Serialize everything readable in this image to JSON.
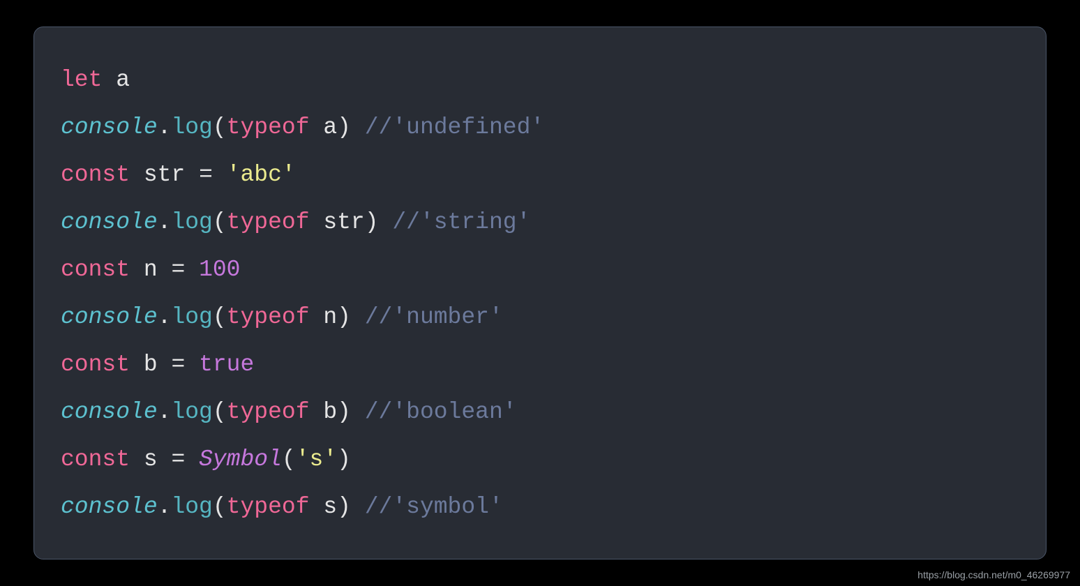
{
  "watermark": "https://blog.csdn.net/m0_46269977",
  "code": {
    "lines": [
      [
        {
          "t": "let",
          "c": "kw"
        },
        {
          "t": " ",
          "c": "punct"
        },
        {
          "t": "a",
          "c": "ident"
        }
      ],
      [
        {
          "t": "console",
          "c": "obj"
        },
        {
          "t": ".",
          "c": "punct"
        },
        {
          "t": "log",
          "c": "method"
        },
        {
          "t": "(",
          "c": "punct"
        },
        {
          "t": "typeof",
          "c": "kw"
        },
        {
          "t": " ",
          "c": "punct"
        },
        {
          "t": "a",
          "c": "ident"
        },
        {
          "t": ") ",
          "c": "punct"
        },
        {
          "t": "//'undefined'",
          "c": "comment"
        }
      ],
      [
        {
          "t": "const",
          "c": "kw"
        },
        {
          "t": " ",
          "c": "punct"
        },
        {
          "t": "str",
          "c": "ident"
        },
        {
          "t": " = ",
          "c": "punct"
        },
        {
          "t": "'abc'",
          "c": "str"
        }
      ],
      [
        {
          "t": "console",
          "c": "obj"
        },
        {
          "t": ".",
          "c": "punct"
        },
        {
          "t": "log",
          "c": "method"
        },
        {
          "t": "(",
          "c": "punct"
        },
        {
          "t": "typeof",
          "c": "kw"
        },
        {
          "t": " ",
          "c": "punct"
        },
        {
          "t": "str",
          "c": "ident"
        },
        {
          "t": ") ",
          "c": "punct"
        },
        {
          "t": "//'string'",
          "c": "comment"
        }
      ],
      [
        {
          "t": "const",
          "c": "kw"
        },
        {
          "t": " ",
          "c": "punct"
        },
        {
          "t": "n",
          "c": "ident"
        },
        {
          "t": " = ",
          "c": "punct"
        },
        {
          "t": "100",
          "c": "num"
        }
      ],
      [
        {
          "t": "console",
          "c": "obj"
        },
        {
          "t": ".",
          "c": "punct"
        },
        {
          "t": "log",
          "c": "method"
        },
        {
          "t": "(",
          "c": "punct"
        },
        {
          "t": "typeof",
          "c": "kw"
        },
        {
          "t": " ",
          "c": "punct"
        },
        {
          "t": "n",
          "c": "ident"
        },
        {
          "t": ") ",
          "c": "punct"
        },
        {
          "t": "//'number'",
          "c": "comment"
        }
      ],
      [
        {
          "t": "const",
          "c": "kw"
        },
        {
          "t": " ",
          "c": "punct"
        },
        {
          "t": "b",
          "c": "ident"
        },
        {
          "t": " = ",
          "c": "punct"
        },
        {
          "t": "true",
          "c": "bool"
        }
      ],
      [
        {
          "t": "console",
          "c": "obj"
        },
        {
          "t": ".",
          "c": "punct"
        },
        {
          "t": "log",
          "c": "method"
        },
        {
          "t": "(",
          "c": "punct"
        },
        {
          "t": "typeof",
          "c": "kw"
        },
        {
          "t": " ",
          "c": "punct"
        },
        {
          "t": "b",
          "c": "ident"
        },
        {
          "t": ") ",
          "c": "punct"
        },
        {
          "t": "//'boolean'",
          "c": "comment"
        }
      ],
      [
        {
          "t": "const",
          "c": "kw"
        },
        {
          "t": " ",
          "c": "punct"
        },
        {
          "t": "s",
          "c": "ident"
        },
        {
          "t": " = ",
          "c": "punct"
        },
        {
          "t": "Symbol",
          "c": "func"
        },
        {
          "t": "(",
          "c": "punct"
        },
        {
          "t": "'s'",
          "c": "str"
        },
        {
          "t": ")",
          "c": "punct"
        }
      ],
      [
        {
          "t": "console",
          "c": "obj"
        },
        {
          "t": ".",
          "c": "punct"
        },
        {
          "t": "log",
          "c": "method"
        },
        {
          "t": "(",
          "c": "punct"
        },
        {
          "t": "typeof",
          "c": "kw"
        },
        {
          "t": " ",
          "c": "punct"
        },
        {
          "t": "s",
          "c": "ident"
        },
        {
          "t": ") ",
          "c": "punct"
        },
        {
          "t": "//'symbol'",
          "c": "comment"
        }
      ]
    ]
  }
}
